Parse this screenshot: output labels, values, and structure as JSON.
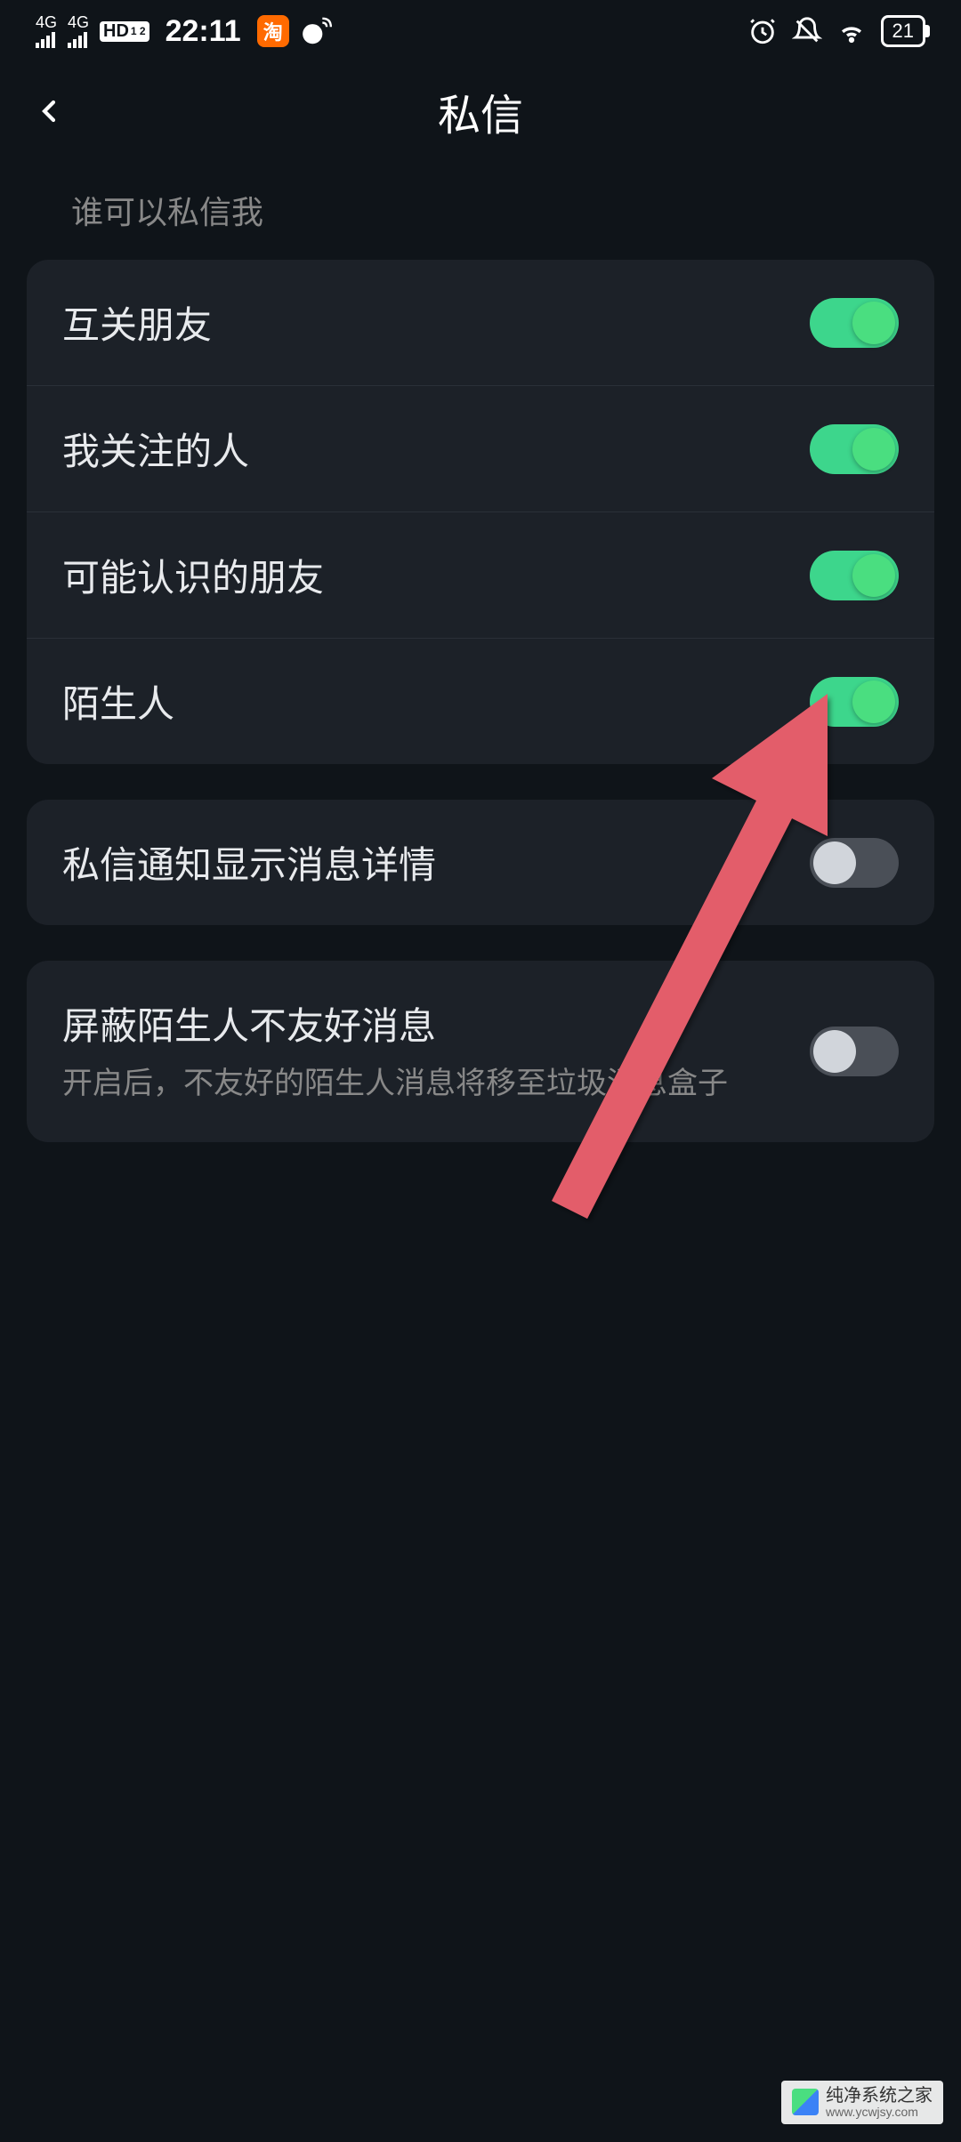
{
  "statusBar": {
    "signal1": "4G",
    "signal2": "4G",
    "hd": "HD",
    "sim": "1 2",
    "time": "22:11",
    "taoLabel": "淘",
    "battery": "21"
  },
  "header": {
    "title": "私信"
  },
  "section": {
    "whoCanMessage": "谁可以私信我"
  },
  "group1": {
    "items": [
      {
        "label": "互关朋友",
        "on": true
      },
      {
        "label": "我关注的人",
        "on": true
      },
      {
        "label": "可能认识的朋友",
        "on": true
      },
      {
        "label": "陌生人",
        "on": true
      }
    ]
  },
  "group2": {
    "items": [
      {
        "label": "私信通知显示消息详情",
        "on": false
      }
    ]
  },
  "group3": {
    "items": [
      {
        "label": "屏蔽陌生人不友好消息",
        "subtitle": "开启后，不友好的陌生人消息将移至垃圾消息盒子",
        "on": false
      }
    ]
  },
  "watermark": {
    "title": "纯净系统之家",
    "url": "www.ycwjsy.com"
  },
  "colors": {
    "toggleOn": "#3dd68c",
    "toggleOff": "#4a4f57",
    "background": "#0f1419",
    "cardBackground": "#1c2128",
    "arrowColor": "#e35d6a"
  }
}
